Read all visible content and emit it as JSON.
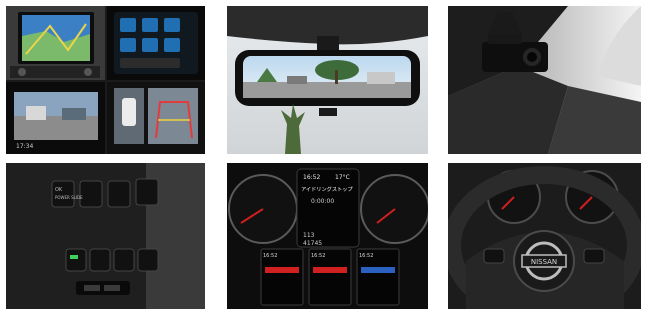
{
  "panels": [
    {
      "id": "t1",
      "subject": "nav-and-around-view-monitor"
    },
    {
      "id": "t2",
      "subject": "intelligent-rearview-mirror"
    },
    {
      "id": "t3",
      "subject": "dashcam"
    },
    {
      "id": "t4",
      "subject": "dash-switch-panel"
    },
    {
      "id": "t5",
      "subject": "instrument-cluster-display"
    },
    {
      "id": "t6",
      "subject": "steering-wheel"
    }
  ],
  "screens": {
    "around_view_time": "17:34",
    "cluster_time": "16:52",
    "cluster_temp": "17°C",
    "idle_stop_label": "アイドリングストップ",
    "cluster_value": "0:00:00",
    "odo": "113",
    "trip": "41745",
    "sub1_time": "16:52",
    "sub2_time": "16:52",
    "sub3_time": "16:52"
  },
  "switches": {
    "sw1": "OK",
    "sw2": "POWER\nSLIDE"
  },
  "brand": "NISSAN",
  "colors": {
    "screen_red": "#d02020",
    "screen_blue": "#2a60c0",
    "dash_black": "#141414"
  }
}
